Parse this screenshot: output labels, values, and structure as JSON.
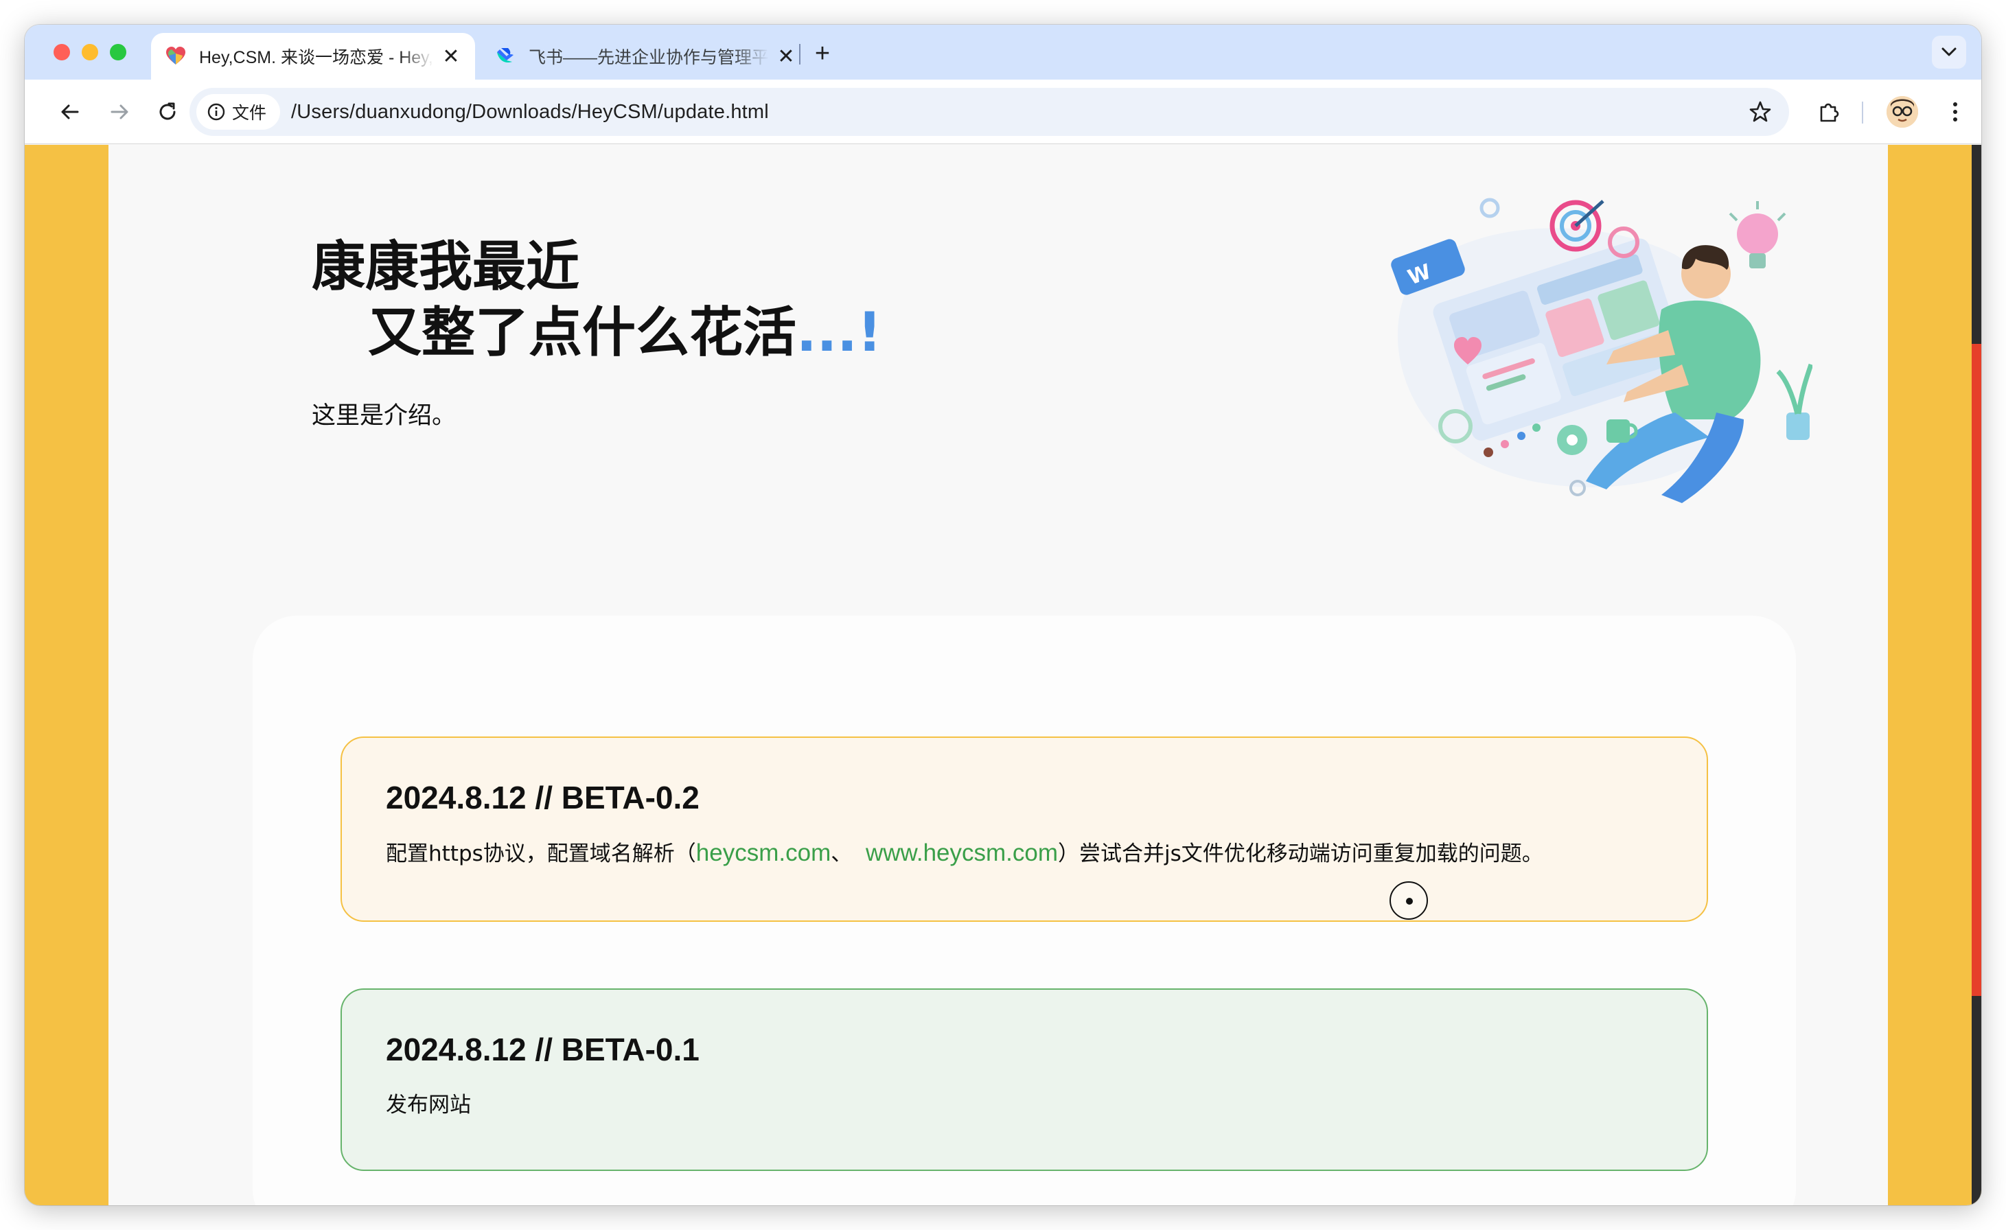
{
  "browser": {
    "tabs": [
      {
        "title": "Hey,CSM. 来谈一场恋爱 - Hey,CSM",
        "active": true,
        "favicon": "heart-favicon"
      },
      {
        "title": "飞书——先进企业协作与管理平台",
        "active": false,
        "favicon": "feishu-favicon"
      }
    ],
    "new_tab_label": "+",
    "close_label": "✕",
    "address": {
      "scheme_label": "文件",
      "url": "/Users/duanxudong/Downloads/HeyCSM/update.html"
    }
  },
  "hero": {
    "title_line1": "康康我最近",
    "title_line2": "又整了点什么花活",
    "title_accent": "...!",
    "intro": "这里是介绍。"
  },
  "updates": [
    {
      "heading": "2024.8.12 // BETA-0.2",
      "text_before": "配置https协议，配置域名解析（",
      "link1": "heycsm.com",
      "separator": "、",
      "link2": "www.heycsm.com",
      "text_after": "）尝试合并js文件优化移动端访问重复加载的问题。"
    },
    {
      "heading": "2024.8.12 // BETA-0.1",
      "text": "发布网站"
    }
  ],
  "colors": {
    "page_side": "#f5c144",
    "accent_blue": "#4a90e2",
    "link_green": "#3a9f49",
    "beta2_border": "#f5c144",
    "beta1_border": "#67b46c"
  }
}
